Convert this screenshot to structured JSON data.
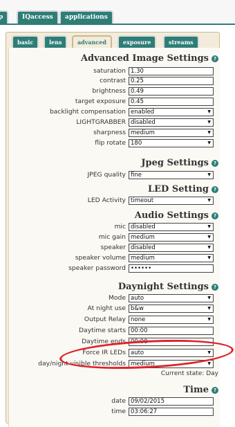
{
  "top_tabs": [
    "p",
    "IQaccess",
    "applications"
  ],
  "sub_tabs": [
    "basic",
    "lens",
    "advanced",
    "exposure",
    "streams"
  ],
  "active_sub_tab": "advanced",
  "sections": {
    "advanced": {
      "title": "Advanced Image Settings",
      "rows": [
        {
          "label": "saturation",
          "value": "1.30",
          "type": "text"
        },
        {
          "label": "contrast",
          "value": "0.25",
          "type": "text"
        },
        {
          "label": "brightness",
          "value": "0.49",
          "type": "text"
        },
        {
          "label": "target exposure",
          "value": "0.45",
          "type": "text"
        },
        {
          "label": "backlight compensation",
          "value": "enabled",
          "type": "select"
        },
        {
          "label": "LIGHTGRABBER",
          "value": "disabled",
          "type": "select"
        },
        {
          "label": "sharpness",
          "value": "medium",
          "type": "select"
        },
        {
          "label": "flip rotate",
          "value": "180",
          "type": "select"
        }
      ]
    },
    "jpeg": {
      "title": "Jpeg Settings",
      "rows": [
        {
          "label": "JPEG quality",
          "value": "fine",
          "type": "select"
        }
      ]
    },
    "led": {
      "title": "LED Setting",
      "rows": [
        {
          "label": "LED Activity",
          "value": "timeout",
          "type": "select"
        }
      ]
    },
    "audio": {
      "title": "Audio Settings",
      "rows": [
        {
          "label": "mic",
          "value": "disabled",
          "type": "select"
        },
        {
          "label": "mic gain",
          "value": "medium",
          "type": "select"
        },
        {
          "label": "speaker",
          "value": "disabled",
          "type": "select"
        },
        {
          "label": "speaker volume",
          "value": "medium",
          "type": "select"
        },
        {
          "label": "speaker password",
          "value": "••••••",
          "type": "text"
        }
      ]
    },
    "daynight": {
      "title": "Daynight Settings",
      "rows": [
        {
          "label": "Mode",
          "value": "auto",
          "type": "select"
        },
        {
          "label": "At night use",
          "value": "b&w",
          "type": "select"
        },
        {
          "label": "Output Relay",
          "value": "none",
          "type": "select"
        },
        {
          "label": "Daytime starts",
          "value": "00:00",
          "type": "text"
        },
        {
          "label": "Daytime ends",
          "value": "00:00",
          "type": "text"
        },
        {
          "label": "Force IR LEDs",
          "value": "auto",
          "type": "select"
        },
        {
          "label": "day/night visible thresholds",
          "value": "medium",
          "type": "select"
        }
      ],
      "current_state": "Current state: Day"
    },
    "time": {
      "title": "Time",
      "rows": [
        {
          "label": "date",
          "value": "09/02/2015",
          "type": "text"
        },
        {
          "label": "time",
          "value": "03:06:27",
          "type": "text"
        }
      ]
    }
  },
  "help_glyph": "?",
  "colors": {
    "tab": "#2e7d77",
    "panel": "#f3ecdc",
    "highlight": "#e0222a"
  }
}
